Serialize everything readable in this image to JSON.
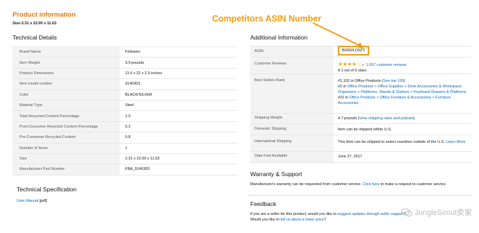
{
  "product": {
    "title": "Product information",
    "size_label": "Size:",
    "size_value": "2.31 x 22.00 x 11.63"
  },
  "tech_details": {
    "title": "Technical Details",
    "rows": [
      {
        "label": "Brand Name",
        "value": "Fellowes"
      },
      {
        "label": "Item Weight",
        "value": "3.9 pounds"
      },
      {
        "label": "Product Dimensions",
        "value": "11.6 x 22 x 2.3 inches"
      },
      {
        "label": "Item model number",
        "value": "9140303"
      },
      {
        "label": "Color",
        "value": "BLACK/SILVER"
      },
      {
        "label": "Material Type",
        "value": "Steel"
      },
      {
        "label": "Total Recycled Content Percentage",
        "value": "1.0"
      },
      {
        "label": "Post-Consumer Recycled Content Percentage",
        "value": "0.2"
      },
      {
        "label": "Pre-Consumer Recycled Content",
        "value": "0.8"
      },
      {
        "label": "Number of Items",
        "value": "1"
      },
      {
        "label": "Size",
        "value": "2.31 x 22.00 x 11.63"
      },
      {
        "label": "Manufacturer Part Number",
        "value": "FBA_9140303"
      }
    ]
  },
  "tech_spec": {
    "title": "Technical Specification",
    "manual_link": "User Manual",
    "manual_suffix": "[pdf]"
  },
  "annotation": {
    "text": "Competitors ASIN Number",
    "color": "#f39c12"
  },
  "additional": {
    "title": "Additional Information",
    "asin_label": "ASIN",
    "asin_value": "B0002LD0ZY",
    "reviews_label": "Customer Reviews",
    "stars": "★★★★☆",
    "review_count": "1,057 customer reviews",
    "rating_text": "4.1 out of 5 stars",
    "bsr_label": "Best Sellers Rank",
    "bsr_line1_a": "#1,102 in Office Products (",
    "bsr_line1_link": "See top 100",
    "bsr_line1_b": ")",
    "bsr_line2_a": "#1 in ",
    "bsr_line2_link": "Office Products > Office Supplies > Desk Accessories & Workspace Organizers > Platforms, Stands & Shelves > Keyboard Drawers & Platforms",
    "bsr_line3_a": "#21 in ",
    "bsr_line3_link": "Office Products > Office Furniture & Accessories > Furniture Accessories",
    "shipweight_label": "Shipping Weight",
    "shipweight_value": "4.7 pounds (",
    "shipweight_link": "View shipping rates and policies",
    "shipweight_end": ")",
    "domestic_label": "Domestic Shipping",
    "domestic_value": "Item can be shipped within U.S.",
    "intl_label": "International Shipping",
    "intl_value": "This item can be shipped to select countries outside of the U.S.",
    "intl_link": "Learn More",
    "date_label": "Date First Available",
    "date_value": "June 27, 2017"
  },
  "warranty": {
    "title": "Warranty & Support",
    "text_a": "Manufacturer's warranty can be requested from customer service.",
    "link": "Click here",
    "text_b": "to make a request to customer service."
  },
  "feedback": {
    "title": "Feedback",
    "line1_a": "If you are a seller for this product, would you like to",
    "line1_link": "suggest updates through seller support",
    "line1_b": "?",
    "line2_a": "Would you like to",
    "line2_link": "tell us about a lower price",
    "line2_b": "?"
  },
  "watermark": {
    "text": "JungleScout卖家"
  }
}
